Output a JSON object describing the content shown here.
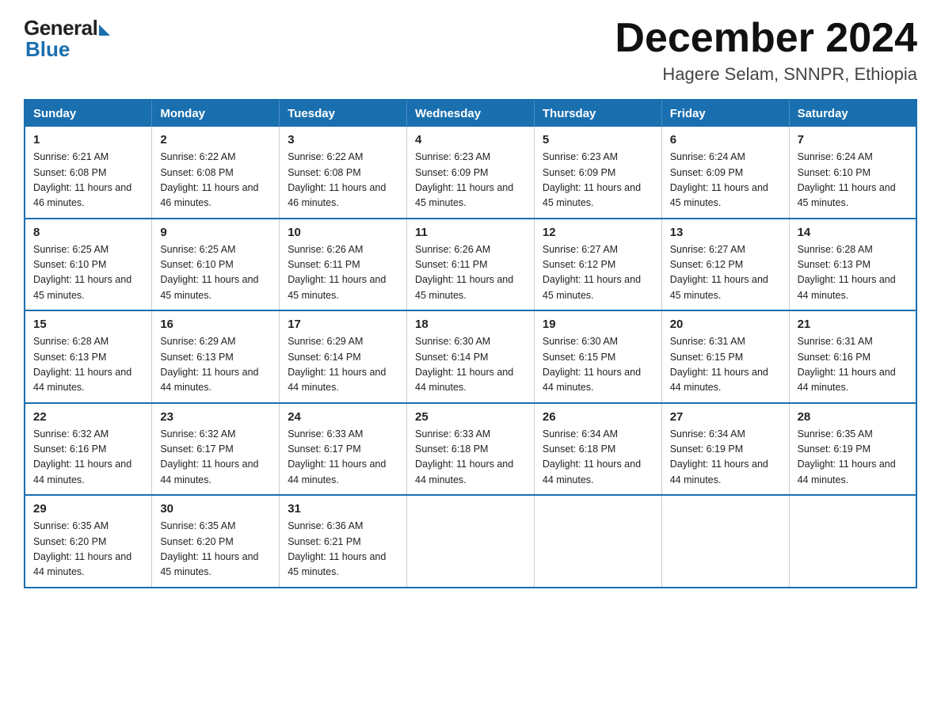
{
  "header": {
    "logo_general": "General",
    "logo_blue": "Blue",
    "month_year": "December 2024",
    "location": "Hagere Selam, SNNPR, Ethiopia"
  },
  "weekdays": [
    "Sunday",
    "Monday",
    "Tuesday",
    "Wednesday",
    "Thursday",
    "Friday",
    "Saturday"
  ],
  "weeks": [
    [
      {
        "day": "1",
        "sunrise": "6:21 AM",
        "sunset": "6:08 PM",
        "daylight": "11 hours and 46 minutes."
      },
      {
        "day": "2",
        "sunrise": "6:22 AM",
        "sunset": "6:08 PM",
        "daylight": "11 hours and 46 minutes."
      },
      {
        "day": "3",
        "sunrise": "6:22 AM",
        "sunset": "6:08 PM",
        "daylight": "11 hours and 46 minutes."
      },
      {
        "day": "4",
        "sunrise": "6:23 AM",
        "sunset": "6:09 PM",
        "daylight": "11 hours and 45 minutes."
      },
      {
        "day": "5",
        "sunrise": "6:23 AM",
        "sunset": "6:09 PM",
        "daylight": "11 hours and 45 minutes."
      },
      {
        "day": "6",
        "sunrise": "6:24 AM",
        "sunset": "6:09 PM",
        "daylight": "11 hours and 45 minutes."
      },
      {
        "day": "7",
        "sunrise": "6:24 AM",
        "sunset": "6:10 PM",
        "daylight": "11 hours and 45 minutes."
      }
    ],
    [
      {
        "day": "8",
        "sunrise": "6:25 AM",
        "sunset": "6:10 PM",
        "daylight": "11 hours and 45 minutes."
      },
      {
        "day": "9",
        "sunrise": "6:25 AM",
        "sunset": "6:10 PM",
        "daylight": "11 hours and 45 minutes."
      },
      {
        "day": "10",
        "sunrise": "6:26 AM",
        "sunset": "6:11 PM",
        "daylight": "11 hours and 45 minutes."
      },
      {
        "day": "11",
        "sunrise": "6:26 AM",
        "sunset": "6:11 PM",
        "daylight": "11 hours and 45 minutes."
      },
      {
        "day": "12",
        "sunrise": "6:27 AM",
        "sunset": "6:12 PM",
        "daylight": "11 hours and 45 minutes."
      },
      {
        "day": "13",
        "sunrise": "6:27 AM",
        "sunset": "6:12 PM",
        "daylight": "11 hours and 45 minutes."
      },
      {
        "day": "14",
        "sunrise": "6:28 AM",
        "sunset": "6:13 PM",
        "daylight": "11 hours and 44 minutes."
      }
    ],
    [
      {
        "day": "15",
        "sunrise": "6:28 AM",
        "sunset": "6:13 PM",
        "daylight": "11 hours and 44 minutes."
      },
      {
        "day": "16",
        "sunrise": "6:29 AM",
        "sunset": "6:13 PM",
        "daylight": "11 hours and 44 minutes."
      },
      {
        "day": "17",
        "sunrise": "6:29 AM",
        "sunset": "6:14 PM",
        "daylight": "11 hours and 44 minutes."
      },
      {
        "day": "18",
        "sunrise": "6:30 AM",
        "sunset": "6:14 PM",
        "daylight": "11 hours and 44 minutes."
      },
      {
        "day": "19",
        "sunrise": "6:30 AM",
        "sunset": "6:15 PM",
        "daylight": "11 hours and 44 minutes."
      },
      {
        "day": "20",
        "sunrise": "6:31 AM",
        "sunset": "6:15 PM",
        "daylight": "11 hours and 44 minutes."
      },
      {
        "day": "21",
        "sunrise": "6:31 AM",
        "sunset": "6:16 PM",
        "daylight": "11 hours and 44 minutes."
      }
    ],
    [
      {
        "day": "22",
        "sunrise": "6:32 AM",
        "sunset": "6:16 PM",
        "daylight": "11 hours and 44 minutes."
      },
      {
        "day": "23",
        "sunrise": "6:32 AM",
        "sunset": "6:17 PM",
        "daylight": "11 hours and 44 minutes."
      },
      {
        "day": "24",
        "sunrise": "6:33 AM",
        "sunset": "6:17 PM",
        "daylight": "11 hours and 44 minutes."
      },
      {
        "day": "25",
        "sunrise": "6:33 AM",
        "sunset": "6:18 PM",
        "daylight": "11 hours and 44 minutes."
      },
      {
        "day": "26",
        "sunrise": "6:34 AM",
        "sunset": "6:18 PM",
        "daylight": "11 hours and 44 minutes."
      },
      {
        "day": "27",
        "sunrise": "6:34 AM",
        "sunset": "6:19 PM",
        "daylight": "11 hours and 44 minutes."
      },
      {
        "day": "28",
        "sunrise": "6:35 AM",
        "sunset": "6:19 PM",
        "daylight": "11 hours and 44 minutes."
      }
    ],
    [
      {
        "day": "29",
        "sunrise": "6:35 AM",
        "sunset": "6:20 PM",
        "daylight": "11 hours and 44 minutes."
      },
      {
        "day": "30",
        "sunrise": "6:35 AM",
        "sunset": "6:20 PM",
        "daylight": "11 hours and 45 minutes."
      },
      {
        "day": "31",
        "sunrise": "6:36 AM",
        "sunset": "6:21 PM",
        "daylight": "11 hours and 45 minutes."
      },
      null,
      null,
      null,
      null
    ]
  ]
}
